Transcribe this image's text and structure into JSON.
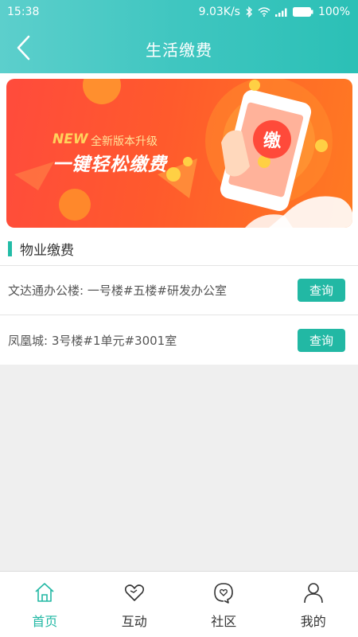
{
  "status_bar": {
    "time": "15:38",
    "network_speed": "9.03K/s",
    "battery": "100%"
  },
  "nav": {
    "title": "生活缴费"
  },
  "banner": {
    "new_label": "NEW",
    "subtitle": "全新版本升级",
    "headline": "一键轻松缴费",
    "badge": "缴"
  },
  "section": {
    "title": "物业缴费"
  },
  "properties": [
    {
      "label": "文达通办公楼: 一号楼#五楼#研发办公室",
      "button": "查询"
    },
    {
      "label": "凤凰城: 3号楼#1单元#3001室",
      "button": "查询"
    }
  ],
  "tabs": [
    {
      "label": "首页",
      "icon": "home-icon",
      "active": true
    },
    {
      "label": "互动",
      "icon": "heart-icon",
      "active": false
    },
    {
      "label": "社区",
      "icon": "community-icon",
      "active": false
    },
    {
      "label": "我的",
      "icon": "user-icon",
      "active": false
    }
  ],
  "colors": {
    "accent": "#22b8a4",
    "header_start": "#5ccfcc",
    "header_end": "#2bc0b6"
  }
}
